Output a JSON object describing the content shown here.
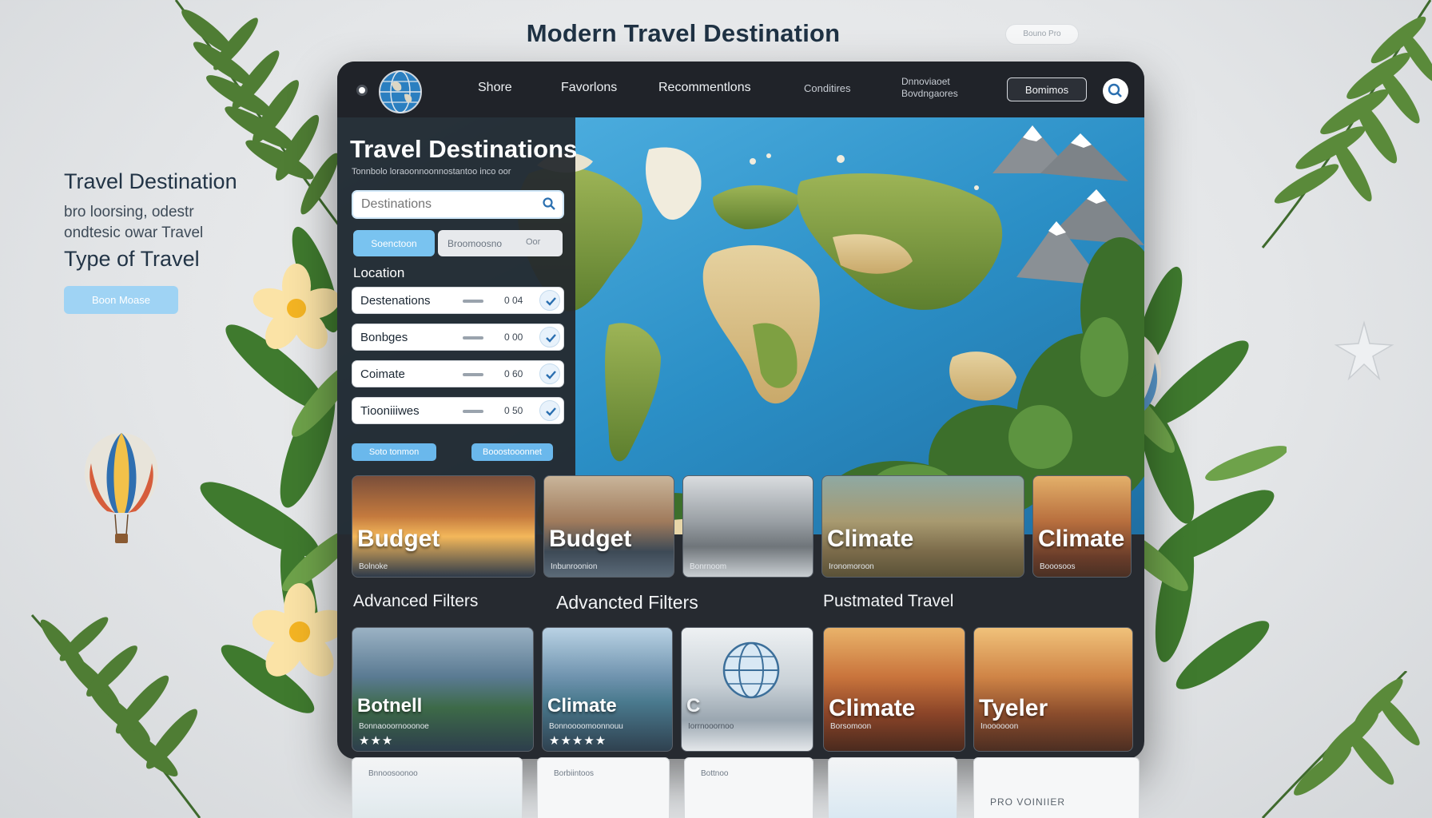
{
  "page": {
    "title": "Modern Travel Destination",
    "corner_pill": "Bouno Pro"
  },
  "left_copy": {
    "heading": "Travel Destination",
    "body_line1": "bro loorsing, odestr",
    "body_line2": "ondtesic owar Travel",
    "heading2": "Type of Travel",
    "button": "Boon Moase"
  },
  "nav": {
    "items": [
      "Shore",
      "Favorlons",
      "Recommentlons",
      "Conditires"
    ],
    "two_line": [
      "Dnnoviaoet",
      "Bovdngaores"
    ],
    "button": "Bomimos"
  },
  "panel": {
    "title": "Travel Destinations",
    "subtitle": "Tonnbolo loraoonnoonnostantoo inco oor",
    "search_placeholder": "Destinations",
    "seg_active": "Soenctoon",
    "seg_2": "Broomoosno",
    "seg_2_tag": "Oor",
    "location_label": "Location",
    "filters": [
      {
        "label": "Destenations",
        "value": "0 04"
      },
      {
        "label": "Bonbges",
        "value": "0 00"
      },
      {
        "label": "Coimate",
        "value": "0 60"
      },
      {
        "label": "Tiooniiiwes",
        "value": "0 50"
      }
    ],
    "btn_a": "Soto tonmon",
    "btn_b": "Booostooonnet"
  },
  "row1": [
    {
      "title": "Budget",
      "sub": "Bolnoke"
    },
    {
      "title": "Budget",
      "sub": "Inbunroonion"
    },
    {
      "title": "",
      "sub": "Bonrnoom"
    },
    {
      "title": "Climate",
      "sub": "Ironomoroon"
    },
    {
      "title": "Climate",
      "sub": "Booosoos"
    }
  ],
  "sections": [
    "Advanced Filters",
    "Advancted Filters",
    "Pustmated Travel"
  ],
  "row2": [
    {
      "title": "Botnell",
      "sub": "Bonnaooornooonoe",
      "stars": "★★★"
    },
    {
      "title": "Climate",
      "sub": "Bonnoooomoonnouu",
      "stars": "★★★★★"
    },
    {
      "title": "C",
      "sub": "Iorrnooornoo",
      "stars": ""
    },
    {
      "title": "Climate",
      "sub": "Borsomoon",
      "stars": ""
    },
    {
      "title": "Tyeler",
      "sub": "Inoooooon",
      "stars": ""
    }
  ],
  "peek": [
    "Bnnoosoonoo",
    "Borbiintoos",
    "Bottnoo",
    "",
    "PRO VOINIIER"
  ],
  "colors": {
    "accent": "#79c3f0",
    "window": "#262a30",
    "ocean": "#2b8fc6",
    "land": "#7c9a3c"
  },
  "icons": [
    "globe-icon",
    "search-icon",
    "check-icon",
    "balloon-icon",
    "plumeria-icon",
    "palm-leaf-icon",
    "starfish-icon"
  ]
}
